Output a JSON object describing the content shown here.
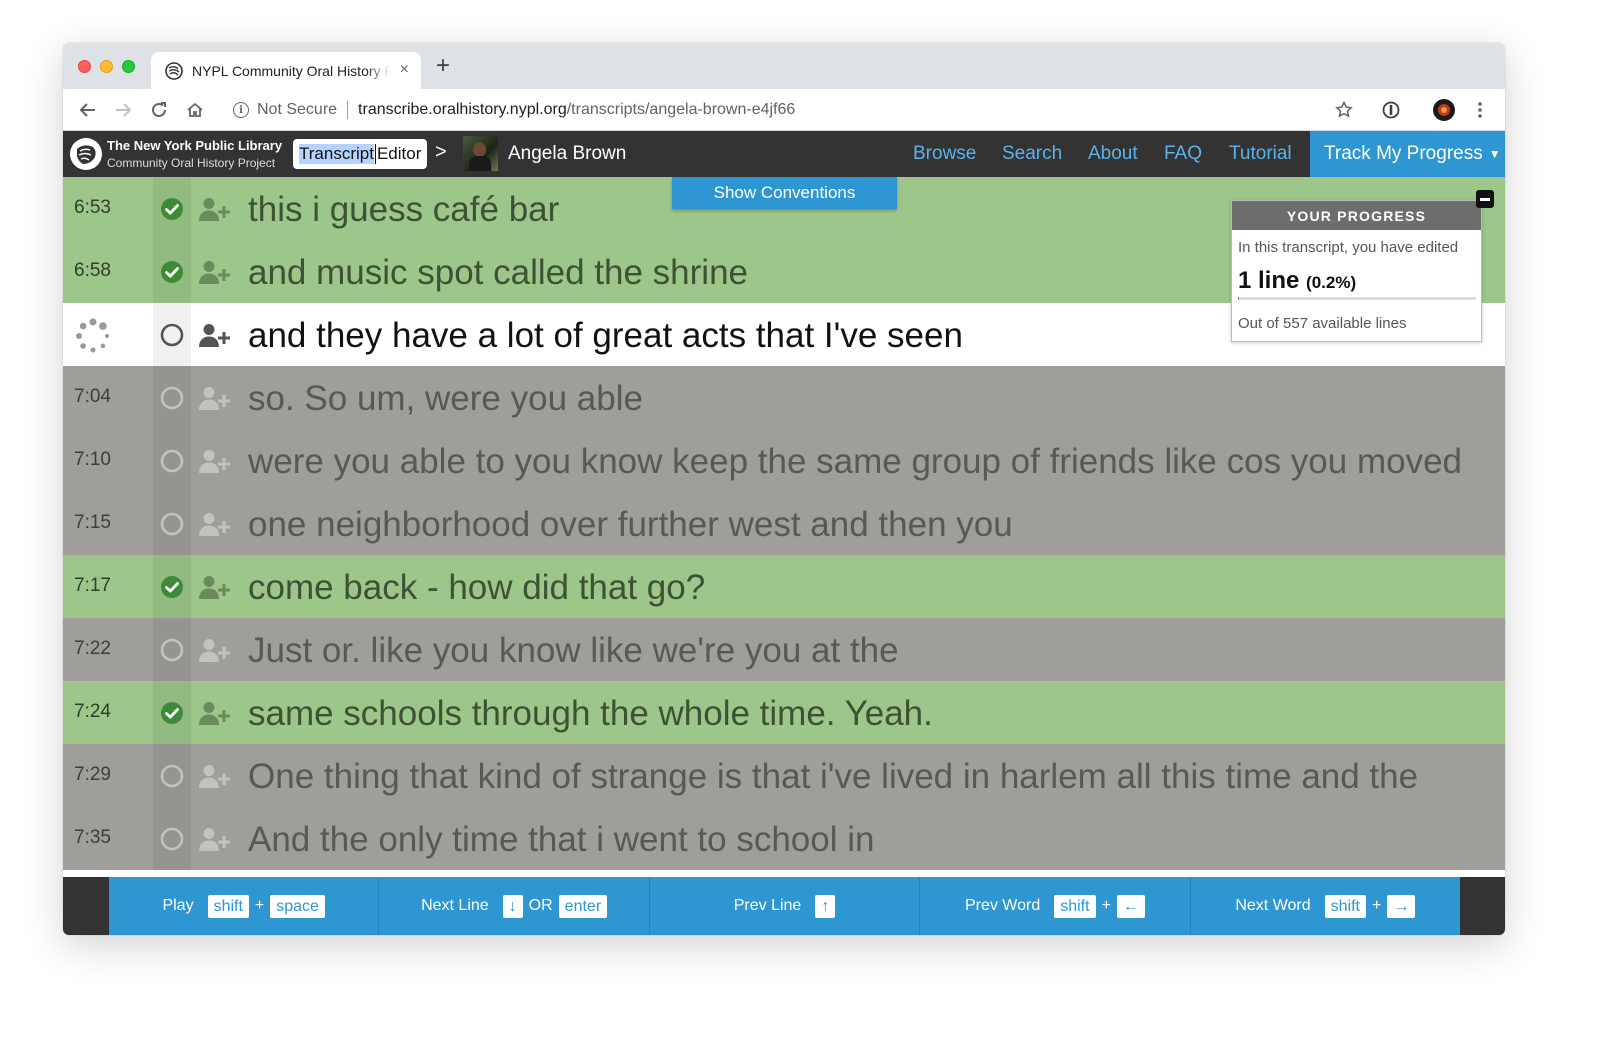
{
  "browser": {
    "tab_title": "NYPL Community Oral History Project",
    "new_tab": "+",
    "close": "×",
    "security_label": "Not Secure",
    "url_host": "transcribe.oralhistory.nypl.org",
    "url_path": "/transcripts/angela-brown-e4jf66"
  },
  "app": {
    "brand_line1": "The New York Public Library",
    "brand_line2": "Community Oral History Project",
    "editor_part1": "Transcript",
    "editor_part2": "Editor",
    "breadcrumb_chevron": ">",
    "narrator": "Angela Brown",
    "nav": [
      "Browse",
      "Search",
      "About",
      "FAQ",
      "Tutorial"
    ],
    "track_progress": "Track My Progress",
    "show_conventions": "Show Conventions"
  },
  "lines": [
    {
      "time": "6:53",
      "text": "this i guess café bar",
      "status": "green"
    },
    {
      "time": "6:58",
      "text": "and music spot called the shrine",
      "status": "green"
    },
    {
      "time": "",
      "text": "and they have a lot of great acts that I've seen",
      "status": "active"
    },
    {
      "time": "7:04",
      "text": "so. So um, were you able",
      "status": "gray"
    },
    {
      "time": "7:10",
      "text": "were you able to you know keep the same group of friends like cos you moved",
      "status": "gray"
    },
    {
      "time": "7:15",
      "text": "one neighborhood over further west and then you",
      "status": "gray"
    },
    {
      "time": "7:17",
      "text": "come back - how did that go?",
      "status": "green"
    },
    {
      "time": "7:22",
      "text": "Just or. like you know like we're you at the",
      "status": "gray"
    },
    {
      "time": "7:24",
      "text": "same schools through the whole time. Yeah.",
      "status": "green"
    },
    {
      "time": "7:29",
      "text": "One thing that kind of strange is that i've lived in harlem all this time and the",
      "status": "gray"
    },
    {
      "time": "7:35",
      "text": "And the only time that i went to school in",
      "status": "gray"
    }
  ],
  "progress": {
    "heading": "YOUR PROGRESS",
    "subtitle": "In this transcript, you have edited",
    "count": "1 line",
    "percent": "(0.2%)",
    "percent_value": 0.002,
    "footer": "Out of 557 available lines"
  },
  "shortcuts": {
    "play": {
      "label": "Play",
      "k1": "shift",
      "plus": "+",
      "k2": "space"
    },
    "next_line": {
      "label": "Next Line",
      "k1": "↓",
      "or": "OR",
      "k2": "enter"
    },
    "prev_line": {
      "label": "Prev Line",
      "k1": "↑"
    },
    "prev_word": {
      "label": "Prev Word",
      "k1": "shift",
      "plus": "+",
      "k2": "←"
    },
    "next_word": {
      "label": "Next Word",
      "k1": "shift",
      "plus": "+",
      "k2": "→"
    }
  },
  "colors": {
    "accent_blue": "#2e96d2",
    "edited_green": "#9dc78a",
    "unedited_gray": "#a09e9b",
    "nav_dark": "#333333"
  }
}
